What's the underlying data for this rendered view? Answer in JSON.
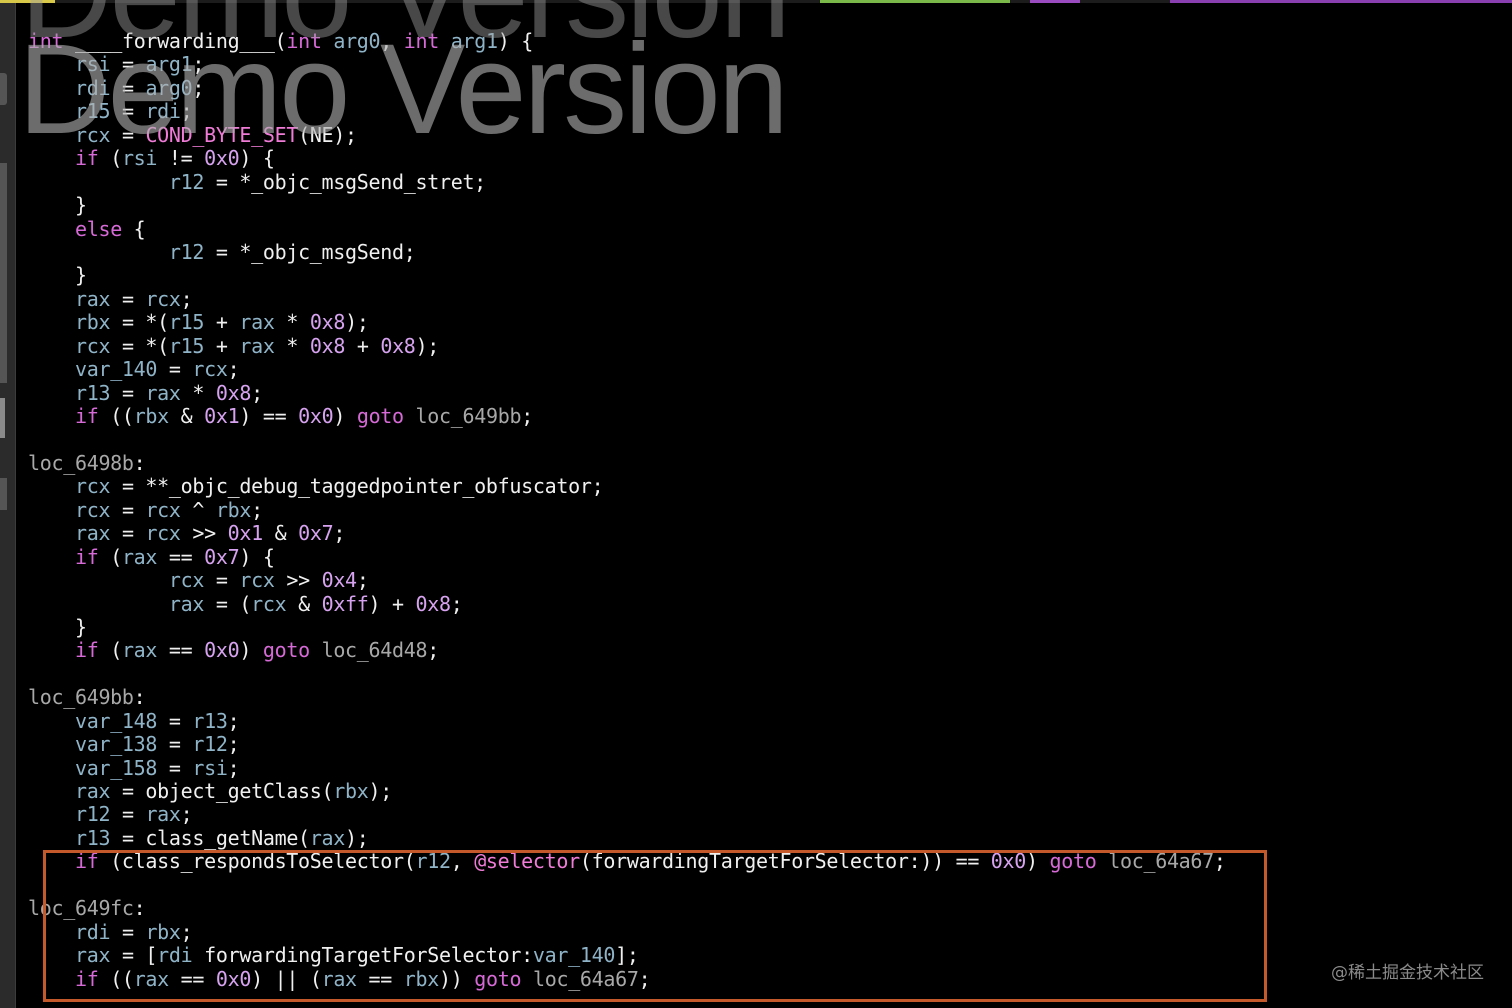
{
  "watermark": {
    "text": "Demo Version"
  },
  "code": {
    "lines": [
      [
        [
          "k",
          "int"
        ],
        [
          "c",
          " "
        ],
        [
          "c",
          "____forwarding___"
        ],
        [
          "c",
          "("
        ],
        [
          "k",
          "int"
        ],
        [
          "c",
          " "
        ],
        [
          "v",
          "arg0"
        ],
        [
          "c",
          ", "
        ],
        [
          "k",
          "int"
        ],
        [
          "c",
          " "
        ],
        [
          "v",
          "arg1"
        ],
        [
          "c",
          ") {"
        ]
      ],
      [
        [
          "c",
          "    "
        ],
        [
          "v",
          "rsi"
        ],
        [
          "c",
          " = "
        ],
        [
          "v",
          "arg1"
        ],
        [
          "c",
          ";"
        ]
      ],
      [
        [
          "c",
          "    "
        ],
        [
          "v",
          "rdi"
        ],
        [
          "c",
          " = "
        ],
        [
          "v",
          "arg0"
        ],
        [
          "c",
          ";"
        ]
      ],
      [
        [
          "c",
          "    "
        ],
        [
          "v",
          "r15"
        ],
        [
          "c",
          " = "
        ],
        [
          "v",
          "rdi"
        ],
        [
          "c",
          ";"
        ]
      ],
      [
        [
          "c",
          "    "
        ],
        [
          "v",
          "rcx"
        ],
        [
          "c",
          " = "
        ],
        [
          "f",
          "COND_BYTE_SET"
        ],
        [
          "c",
          "(NE);"
        ]
      ],
      [
        [
          "c",
          "    "
        ],
        [
          "k",
          "if"
        ],
        [
          "c",
          " ("
        ],
        [
          "v",
          "rsi"
        ],
        [
          "c",
          " != "
        ],
        [
          "n",
          "0x0"
        ],
        [
          "c",
          ") {"
        ]
      ],
      [
        [
          "c",
          "            "
        ],
        [
          "v",
          "r12"
        ],
        [
          "c",
          " = *_objc_msgSend_stret;"
        ]
      ],
      [
        [
          "c",
          "    }"
        ]
      ],
      [
        [
          "c",
          "    "
        ],
        [
          "k",
          "else"
        ],
        [
          "c",
          " {"
        ]
      ],
      [
        [
          "c",
          "            "
        ],
        [
          "v",
          "r12"
        ],
        [
          "c",
          " = *_objc_msgSend;"
        ]
      ],
      [
        [
          "c",
          "    }"
        ]
      ],
      [
        [
          "c",
          "    "
        ],
        [
          "v",
          "rax"
        ],
        [
          "c",
          " = "
        ],
        [
          "v",
          "rcx"
        ],
        [
          "c",
          ";"
        ]
      ],
      [
        [
          "c",
          "    "
        ],
        [
          "v",
          "rbx"
        ],
        [
          "c",
          " = *("
        ],
        [
          "v",
          "r15"
        ],
        [
          "c",
          " + "
        ],
        [
          "v",
          "rax"
        ],
        [
          "c",
          " * "
        ],
        [
          "n",
          "0x8"
        ],
        [
          "c",
          ");"
        ]
      ],
      [
        [
          "c",
          "    "
        ],
        [
          "v",
          "rcx"
        ],
        [
          "c",
          " = *("
        ],
        [
          "v",
          "r15"
        ],
        [
          "c",
          " + "
        ],
        [
          "v",
          "rax"
        ],
        [
          "c",
          " * "
        ],
        [
          "n",
          "0x8"
        ],
        [
          "c",
          " + "
        ],
        [
          "n",
          "0x8"
        ],
        [
          "c",
          ");"
        ]
      ],
      [
        [
          "c",
          "    "
        ],
        [
          "v",
          "var_140"
        ],
        [
          "c",
          " = "
        ],
        [
          "v",
          "rcx"
        ],
        [
          "c",
          ";"
        ]
      ],
      [
        [
          "c",
          "    "
        ],
        [
          "v",
          "r13"
        ],
        [
          "c",
          " = "
        ],
        [
          "v",
          "rax"
        ],
        [
          "c",
          " * "
        ],
        [
          "n",
          "0x8"
        ],
        [
          "c",
          ";"
        ]
      ],
      [
        [
          "c",
          "    "
        ],
        [
          "k",
          "if"
        ],
        [
          "c",
          " (("
        ],
        [
          "v",
          "rbx"
        ],
        [
          "c",
          " & "
        ],
        [
          "n",
          "0x1"
        ],
        [
          "c",
          ") == "
        ],
        [
          "n",
          "0x0"
        ],
        [
          "c",
          ") "
        ],
        [
          "k",
          "goto"
        ],
        [
          "c",
          " "
        ],
        [
          "l",
          "loc_649bb"
        ],
        [
          "c",
          ";"
        ]
      ],
      [],
      [
        [
          "l",
          "loc_6498b"
        ],
        [
          "c",
          ":"
        ]
      ],
      [
        [
          "c",
          "    "
        ],
        [
          "v",
          "rcx"
        ],
        [
          "c",
          " = **_objc_debug_taggedpointer_obfuscator;"
        ]
      ],
      [
        [
          "c",
          "    "
        ],
        [
          "v",
          "rcx"
        ],
        [
          "c",
          " = "
        ],
        [
          "v",
          "rcx"
        ],
        [
          "c",
          " ^ "
        ],
        [
          "v",
          "rbx"
        ],
        [
          "c",
          ";"
        ]
      ],
      [
        [
          "c",
          "    "
        ],
        [
          "v",
          "rax"
        ],
        [
          "c",
          " = "
        ],
        [
          "v",
          "rcx"
        ],
        [
          "c",
          " >> "
        ],
        [
          "n",
          "0x1"
        ],
        [
          "c",
          " & "
        ],
        [
          "n",
          "0x7"
        ],
        [
          "c",
          ";"
        ]
      ],
      [
        [
          "c",
          "    "
        ],
        [
          "k",
          "if"
        ],
        [
          "c",
          " ("
        ],
        [
          "v",
          "rax"
        ],
        [
          "c",
          " == "
        ],
        [
          "n",
          "0x7"
        ],
        [
          "c",
          ") {"
        ]
      ],
      [
        [
          "c",
          "            "
        ],
        [
          "v",
          "rcx"
        ],
        [
          "c",
          " = "
        ],
        [
          "v",
          "rcx"
        ],
        [
          "c",
          " >> "
        ],
        [
          "n",
          "0x4"
        ],
        [
          "c",
          ";"
        ]
      ],
      [
        [
          "c",
          "            "
        ],
        [
          "v",
          "rax"
        ],
        [
          "c",
          " = ("
        ],
        [
          "v",
          "rcx"
        ],
        [
          "c",
          " & "
        ],
        [
          "n",
          "0xff"
        ],
        [
          "c",
          ") + "
        ],
        [
          "n",
          "0x8"
        ],
        [
          "c",
          ";"
        ]
      ],
      [
        [
          "c",
          "    }"
        ]
      ],
      [
        [
          "c",
          "    "
        ],
        [
          "k",
          "if"
        ],
        [
          "c",
          " ("
        ],
        [
          "v",
          "rax"
        ],
        [
          "c",
          " == "
        ],
        [
          "n",
          "0x0"
        ],
        [
          "c",
          ") "
        ],
        [
          "k",
          "goto"
        ],
        [
          "c",
          " "
        ],
        [
          "l",
          "loc_64d48"
        ],
        [
          "c",
          ";"
        ]
      ],
      [],
      [
        [
          "l",
          "loc_649bb"
        ],
        [
          "c",
          ":"
        ]
      ],
      [
        [
          "c",
          "    "
        ],
        [
          "v",
          "var_148"
        ],
        [
          "c",
          " = "
        ],
        [
          "v",
          "r13"
        ],
        [
          "c",
          ";"
        ]
      ],
      [
        [
          "c",
          "    "
        ],
        [
          "v",
          "var_138"
        ],
        [
          "c",
          " = "
        ],
        [
          "v",
          "r12"
        ],
        [
          "c",
          ";"
        ]
      ],
      [
        [
          "c",
          "    "
        ],
        [
          "v",
          "var_158"
        ],
        [
          "c",
          " = "
        ],
        [
          "v",
          "rsi"
        ],
        [
          "c",
          ";"
        ]
      ],
      [
        [
          "c",
          "    "
        ],
        [
          "v",
          "rax"
        ],
        [
          "c",
          " = object_getClass("
        ],
        [
          "v",
          "rbx"
        ],
        [
          "c",
          ");"
        ]
      ],
      [
        [
          "c",
          "    "
        ],
        [
          "v",
          "r12"
        ],
        [
          "c",
          " = "
        ],
        [
          "v",
          "rax"
        ],
        [
          "c",
          ";"
        ]
      ],
      [
        [
          "c",
          "    "
        ],
        [
          "v",
          "r13"
        ],
        [
          "c",
          " = class_getName("
        ],
        [
          "v",
          "rax"
        ],
        [
          "c",
          ");"
        ]
      ],
      [
        [
          "c",
          "    "
        ],
        [
          "k",
          "if"
        ],
        [
          "c",
          " (class_respondsToSelector("
        ],
        [
          "v",
          "r12"
        ],
        [
          "c",
          ", "
        ],
        [
          "f",
          "@selector"
        ],
        [
          "c",
          "(forwardingTargetForSelector:)) == "
        ],
        [
          "n",
          "0x0"
        ],
        [
          "c",
          ") "
        ],
        [
          "k",
          "goto"
        ],
        [
          "c",
          " "
        ],
        [
          "l",
          "loc_64a67"
        ],
        [
          "c",
          ";"
        ]
      ],
      [],
      [
        [
          "l",
          "loc_649fc"
        ],
        [
          "c",
          ":"
        ]
      ],
      [
        [
          "c",
          "    "
        ],
        [
          "v",
          "rdi"
        ],
        [
          "c",
          " = "
        ],
        [
          "v",
          "rbx"
        ],
        [
          "c",
          ";"
        ]
      ],
      [
        [
          "c",
          "    "
        ],
        [
          "v",
          "rax"
        ],
        [
          "c",
          " = ["
        ],
        [
          "v",
          "rdi"
        ],
        [
          "c",
          " forwardingTargetForSelector:"
        ],
        [
          "v",
          "var_140"
        ],
        [
          "c",
          "];"
        ]
      ],
      [
        [
          "c",
          "    "
        ],
        [
          "k",
          "if"
        ],
        [
          "c",
          " (("
        ],
        [
          "v",
          "rax"
        ],
        [
          "c",
          " == "
        ],
        [
          "n",
          "0x0"
        ],
        [
          "c",
          ") || ("
        ],
        [
          "v",
          "rax"
        ],
        [
          "c",
          " == "
        ],
        [
          "v",
          "rbx"
        ],
        [
          "c",
          ")) "
        ],
        [
          "k",
          "goto"
        ],
        [
          "c",
          " "
        ],
        [
          "l",
          "loc_64a67"
        ],
        [
          "c",
          ";"
        ]
      ]
    ]
  },
  "credit": {
    "text": "@稀土掘金技术社区"
  },
  "colors": {
    "keyword": "#d66ad6",
    "variable": "#8fb4c8",
    "number": "#d7a3f0",
    "label": "#a8a8a8",
    "highlight_border": "#c4592c"
  }
}
